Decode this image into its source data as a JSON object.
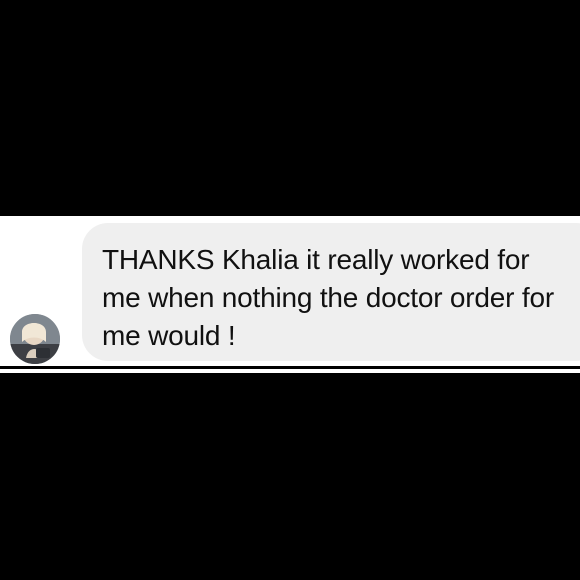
{
  "message": {
    "text": "THANKS Khalia it really worked for me when nothing the doctor order for me would !",
    "bubble_color": "#efefef",
    "text_color": "#111111"
  },
  "avatar": {
    "icon": "user-avatar-photo"
  },
  "colors": {
    "background": "#000000",
    "chat_background": "#ffffff"
  }
}
